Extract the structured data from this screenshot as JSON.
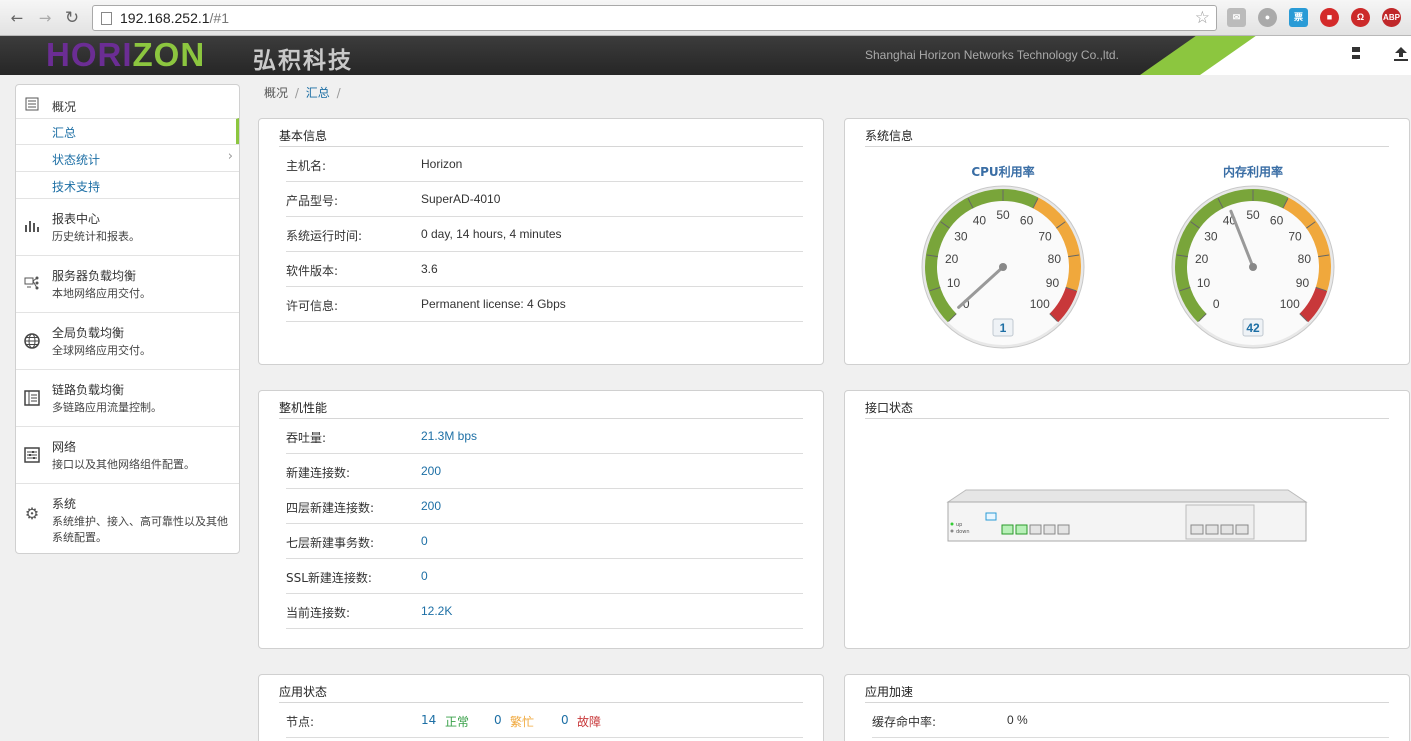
{
  "browser": {
    "url_host": "192.168.252.1",
    "url_path": "/#1"
  },
  "header": {
    "logo_part1": "HORI",
    "logo_part2": "ZON",
    "logo_cn": "弘积科技",
    "company": "Shanghai Horizon Networks Technology Co.,ltd."
  },
  "sidebar": {
    "overview": {
      "title": "概况",
      "items": [
        "汇总",
        "状态统计",
        "技术支持"
      ]
    },
    "sections": [
      {
        "title": "报表中心",
        "desc": "历史统计和报表。",
        "icon": "bar-chart-icon"
      },
      {
        "title": "服务器负载均衡",
        "desc": "本地网络应用交付。",
        "icon": "server-icon"
      },
      {
        "title": "全局负载均衡",
        "desc": "全球网络应用交付。",
        "icon": "globe-icon"
      },
      {
        "title": "链路负载均衡",
        "desc": "多链路应用流量控制。",
        "icon": "list-icon"
      },
      {
        "title": "网络",
        "desc": "接口以及其他网络组件配置。",
        "icon": "sliders-icon"
      },
      {
        "title": "系统",
        "desc": "系统维护、接入、高可靠性以及其他系统配置。",
        "icon": "gear-icon"
      }
    ]
  },
  "breadcrumb": {
    "root": "概况",
    "sep": "/",
    "current": "汇总"
  },
  "basic_info": {
    "title": "基本信息",
    "rows": [
      {
        "k": "主机名:",
        "v": "Horizon"
      },
      {
        "k": "产品型号:",
        "v": "SuperAD-4010"
      },
      {
        "k": "系统运行时间:",
        "v": "0 day, 14 hours, 4 minutes"
      },
      {
        "k": "软件版本:",
        "v": "3.6"
      },
      {
        "k": "许可信息:",
        "v": "Permanent license: 4 Gbps"
      }
    ]
  },
  "system_info": {
    "title": "系统信息",
    "gauges": [
      {
        "label": "CPU利用率",
        "value": 1
      },
      {
        "label": "内存利用率",
        "value": 42
      }
    ],
    "ticks": [
      "0",
      "10",
      "20",
      "30",
      "40",
      "50",
      "60",
      "70",
      "80",
      "90",
      "100"
    ],
    "colors": {
      "green": "#79a53a",
      "yellow": "#f0a83c",
      "red": "#c8383a"
    }
  },
  "performance": {
    "title": "整机性能",
    "rows": [
      {
        "k": "吞吐量:",
        "v": "21.3M bps"
      },
      {
        "k": "新建连接数:",
        "v": "200"
      },
      {
        "k": "四层新建连接数:",
        "v": "200"
      },
      {
        "k": "七层新建事务数:",
        "v": "0"
      },
      {
        "k": "SSL新建连接数:",
        "v": "0"
      },
      {
        "k": "当前连接数:",
        "v": "12.2K"
      }
    ]
  },
  "interfaces": {
    "title": "接口状态",
    "legend_up": "up",
    "legend_down": "down",
    "ports_up": [
      true,
      true,
      false,
      false,
      false
    ],
    "module_ports": 4
  },
  "app_status": {
    "title": "应用状态",
    "label": "节点:",
    "normal_count": "14",
    "normal_label": "正常",
    "busy_count": "0",
    "busy_label": "繁忙",
    "fault_count": "0",
    "fault_label": "故障"
  },
  "app_accel": {
    "title": "应用加速",
    "label": "缓存命中率:",
    "value": "0 %"
  }
}
